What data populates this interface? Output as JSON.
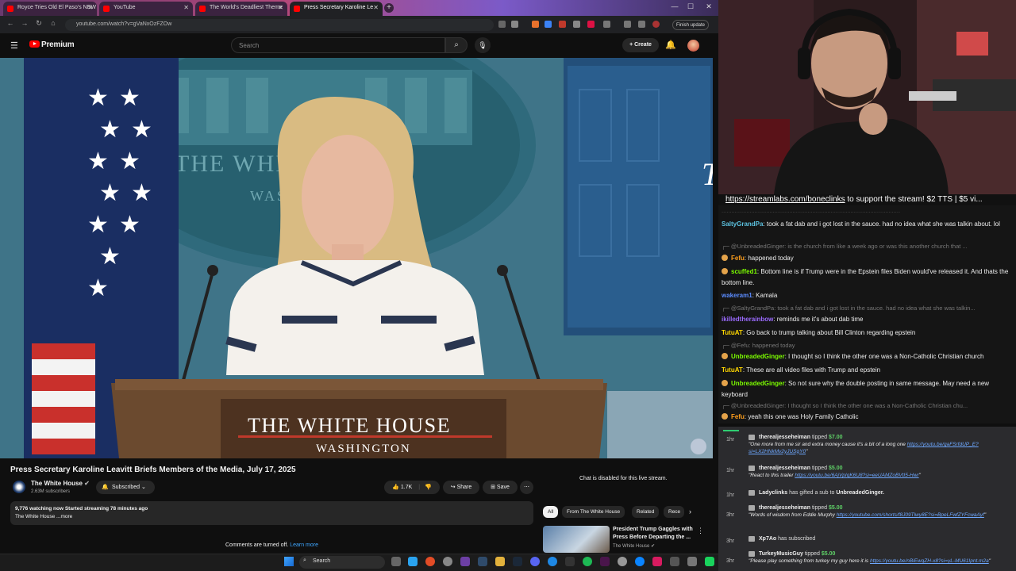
{
  "browser": {
    "tabs": [
      {
        "title": "Royce Tries Old El Paso's NEW"
      },
      {
        "title": "YouTube"
      },
      {
        "title": "The World's Deadliest Theme"
      },
      {
        "title": "Press Secretary Karoline Le"
      }
    ],
    "url": "youtube.com/watch?v=gVaNxOzFZOw",
    "finish_update": "Finish update"
  },
  "youtube": {
    "logo_label": "Premium",
    "search_placeholder": "Search",
    "create_label": "Create",
    "video": {
      "title": "Press Secretary Karoline Leavitt Briefs Members of the Media, July 17, 2025",
      "backdrop_text": "THE WHITE HOUSE",
      "backdrop_sub": "WASHINGTON",
      "podium_title": "THE WHITE HOUSE",
      "podium_sub": "WASHINGTON"
    },
    "channel": {
      "name": "The White House",
      "subscribers": "2.63M subscribers",
      "subscribed_label": "Subscribed"
    },
    "actions": {
      "likes": "1.7K",
      "share": "Share",
      "save": "Save"
    },
    "description": {
      "line1": "9,776 watching now  Started streaming 78 minutes ago",
      "line2": "The White House ...more"
    },
    "comments": {
      "text": "Comments are turned off.",
      "link": "Learn more"
    },
    "chat_disabled": "Chat is disabled for this live stream.",
    "chips": [
      "All",
      "From The White House",
      "Related",
      "Rece"
    ],
    "related": {
      "title": "President Trump Gaggles with Press Before Departing the ...",
      "channel": "The White House"
    }
  },
  "taskbar": {
    "search": "Search"
  },
  "stream": {
    "banner_link": "https://streamlabs.com/boneclinks",
    "banner_text": "to support the stream! $2 TTS | $5 vi..."
  },
  "chat": [
    {
      "kind": "msg",
      "user": "SaltyGrandPa",
      "color": "#5bc0de",
      "text": "took a fat dab and i got lost in the sauce. had no idea what she was talkin about. lol"
    },
    {
      "kind": "reply",
      "text": "@UnbreadedGinger: is the church from like a week ago or was this another church that ..."
    },
    {
      "kind": "msg",
      "badge": true,
      "user": "Fefu",
      "color": "#ff9f1c",
      "text": "happened today"
    },
    {
      "kind": "msg",
      "badge": true,
      "user": "scuffed1",
      "color": "#7cfc00",
      "text": "Bottom line is if Trump were in the Epstein files Biden would've released it. And thats the bottom line."
    },
    {
      "kind": "msg",
      "user": "wakeram1",
      "color": "#5b8cff",
      "text": "Kamala"
    },
    {
      "kind": "reply",
      "text": "@SaltyGrandPa: took a fat dab and i got lost in the sauce. had no idea what she was talkin..."
    },
    {
      "kind": "msg",
      "user": "ikilledtherainbow",
      "color": "#9b6bff",
      "text": "reminds me it's about dab time"
    },
    {
      "kind": "msg",
      "user": "TutuAT",
      "color": "#ffd700",
      "text": "Go back to trump talking about Bill Clinton regarding epstein"
    },
    {
      "kind": "reply",
      "text": "@Fefu: happened today"
    },
    {
      "kind": "msg",
      "badge": true,
      "user": "UnbreadedGinger",
      "color": "#7cfc00",
      "text": "I thought so I think the other one was a Non-Catholic Christian church"
    },
    {
      "kind": "msg",
      "user": "TutuAT",
      "color": "#ffd700",
      "text": "These are all video files with Trump and epstein"
    },
    {
      "kind": "msg",
      "badge": true,
      "user": "UnbreadedGinger",
      "color": "#7cfc00",
      "text": "So not sure why the double posting in same message. May need a new keyboard"
    },
    {
      "kind": "reply",
      "text": "@UnbreadedGinger: I thought so I think the other one was a Non-Catholic Christian chu..."
    },
    {
      "kind": "msg",
      "badge": true,
      "user": "Fefu",
      "color": "#ff9f1c",
      "text": "yeah this one was Holy Family Catholic"
    }
  ],
  "tips": [
    {
      "time": "1hr",
      "user": "therealjesseheiman",
      "action": "tipped",
      "amount": "$7.00",
      "quote": "\"One more from me sir and extra money cause it's a bit of a long one ",
      "link": "https://youtu.be/gaFSrfdUP_E?si=LX2HNkMv2yJUSgY0",
      "end": "\""
    },
    {
      "time": "1hr",
      "user": "therealjesseheiman",
      "action": "tipped",
      "amount": "$5.00",
      "quote": "\"React to this trailer ",
      "link": "https://youtu.be/6AjVpIqK6U8?si=eeUAMZoBVtI5-Hwr",
      "end": "\""
    },
    {
      "time": "1hr",
      "user": "Ladyclinks",
      "action": "has gifted a sub to",
      "amount": "",
      "target": "UnbreadedGinger.",
      "quote": "",
      "link": "",
      "end": ""
    },
    {
      "time": "3hr",
      "user": "therealjesseheiman",
      "action": "tipped",
      "amount": "$5.00",
      "quote": "\"Words of wisdom from Eddie Murphy ",
      "link": "https://youtube.com/shorts/f8J09Tlwy8E?si=BpeLFwfZYFcwaAyf",
      "end": "\""
    },
    {
      "time": "3hr",
      "user": "Xp7Ao",
      "action": "has subscribed",
      "amount": "",
      "quote": "",
      "link": "",
      "end": ""
    },
    {
      "time": "3hr",
      "user": "TurkeyMusicGuy",
      "action": "tipped",
      "amount": "$5.00",
      "quote": "\"Please play something from turkey my guy here it is ",
      "link": "https://youtu.be/nBiEwqZH-x8?si=yL-MU61Ipnt.m2a",
      "end": "\""
    }
  ]
}
